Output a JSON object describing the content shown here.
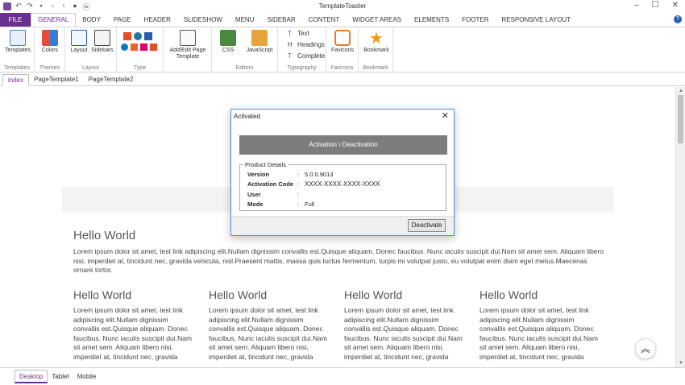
{
  "window": {
    "title": "TemplateToaster"
  },
  "menubar": {
    "file": "FILE",
    "items": [
      "GENERAL",
      "BODY",
      "PAGE",
      "HEADER",
      "SLIDESHOW",
      "MENU",
      "SIDEBAR",
      "CONTENT",
      "WIDGET AREAS",
      "ELEMENTS",
      "FOOTER",
      "RESPONSIVE LAYOUT"
    ]
  },
  "ribbon": {
    "templates": {
      "button": "Templates",
      "group": "Templates"
    },
    "themes": {
      "button": "Colors",
      "group": "Themes"
    },
    "layout": {
      "layout_btn": "Layout",
      "sidebars_btn": "Sidebars",
      "group": "Layout"
    },
    "type": {
      "group": "Type"
    },
    "addedit": {
      "line1": "Add/Edit Page",
      "line2": "Template"
    },
    "editors": {
      "css": "CSS",
      "js": "JavaScript",
      "group": "Editors"
    },
    "typography": {
      "text": "Text",
      "headings": "Headings",
      "complete": "Complete",
      "group": "Typography"
    },
    "favicons": {
      "button": "Favicons",
      "group": "Favicons"
    },
    "bookmark": {
      "button": "Bookmark",
      "group": "Bookmark"
    }
  },
  "page_tabs": [
    "index",
    "PageTemplate1",
    "PageTemplate2"
  ],
  "content": {
    "heading": "Hello World",
    "paragraph": "Lorem ipsum dolor sit amet, test link adipiscing elit.Nullam dignissim convallis est.Quisque aliquam. Donec faucibus. Nunc iaculis suscipit dui.Nam sit amet sem. Aliquam libero nisi, imperdiet at, tincidunt nec, gravida vehicula, nisl.Praesent mattis, massa quis luctus fermentum, turpis mi volutpat justo, eu volutpat enim diam eget metus.Maecenas ornare tortor.",
    "columns": [
      {
        "heading": "Hello World",
        "text": "Lorem ipsum dolor sit amet, test link adipiscing elit.Nullam dignissim convallis est.Quisque aliquam. Donec faucibus. Nunc iaculis suscipit dui.Nam sit amet sem. Aliquam libero nisi, imperdiet at, tincidunt nec, gravida"
      },
      {
        "heading": "Hello World",
        "text": "Lorem ipsum dolor sit amet, test link adipiscing elit.Nullam dignissim convallis est.Quisque aliquam. Donec faucibus. Nunc iaculis suscipit dui.Nam sit amet sem. Aliquam libero nisi, imperdiet at, tincidunt nec, gravida"
      },
      {
        "heading": "Hello World",
        "text": "Lorem ipsum dolor sit amet, test link adipiscing elit.Nullam dignissim convallis est.Quisque aliquam. Donec faucibus. Nunc iaculis suscipit dui.Nam sit amet sem. Aliquam libero nisi, imperdiet at, tincidunt nec, gravida"
      },
      {
        "heading": "Hello World",
        "text": "Lorem ipsum dolor sit amet, test link adipiscing elit.Nullam dignissim convallis est.Quisque aliquam. Donec faucibus. Nunc iaculis suscipit dui.Nam sit amet sem. Aliquam libero nisi, imperdiet at, tincidunt nec, gravida"
      }
    ]
  },
  "device_tabs": [
    "Desktop",
    "Tablet",
    "Mobile"
  ],
  "dialog": {
    "title": "Activated",
    "activation_bar": "Activation \\ Deactivation",
    "legend": "Product Details",
    "rows": [
      {
        "key": "Version",
        "value": "5.0.0.9013"
      },
      {
        "key": "Activation Code",
        "value": "XXXX-XXXX-XXXX-XXXX"
      },
      {
        "key": "User",
        "value": ""
      },
      {
        "key": "Mode",
        "value": "Full"
      }
    ],
    "colon": ":",
    "deactivate": "Deactivate"
  },
  "colors": {
    "accent": "#6b2f8f",
    "dialog_border": "#4a90d9",
    "activation_bar": "#7d7d7d"
  }
}
